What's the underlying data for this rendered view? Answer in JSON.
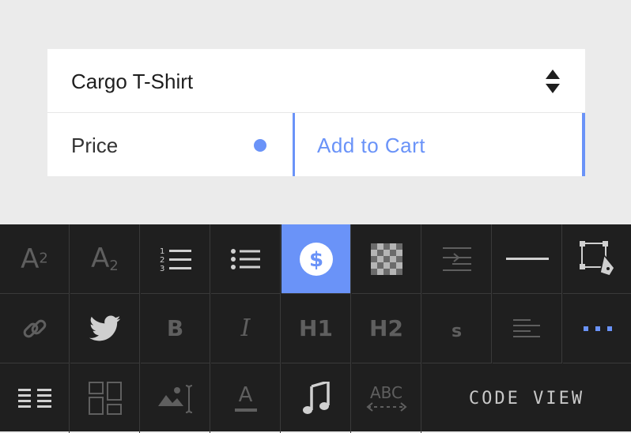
{
  "product": {
    "name": "Cargo T-Shirt"
  },
  "price_row": {
    "label": "Price",
    "cart_label": "Add to Cart"
  },
  "colors": {
    "accent": "#6a93f8",
    "toolbar_bg": "#1f1f1f",
    "icon_gray": "#5f5f5f"
  },
  "toolbar": {
    "row1": [
      {
        "icon": "superscript-icon"
      },
      {
        "icon": "subscript-icon"
      },
      {
        "icon": "ordered-list-icon"
      },
      {
        "icon": "bulleted-list-icon"
      },
      {
        "icon": "dollar-icon",
        "active": true
      },
      {
        "icon": "checkerboard-icon"
      },
      {
        "icon": "indent-icon"
      },
      {
        "icon": "horizontal-rule-icon"
      },
      {
        "icon": "pen-tool-icon"
      }
    ],
    "row2": [
      {
        "icon": "link-icon"
      },
      {
        "icon": "twitter-icon"
      },
      {
        "icon": "bold-icon",
        "label": "B"
      },
      {
        "icon": "italic-icon",
        "label": "I"
      },
      {
        "icon": "heading1-icon",
        "label": "H1"
      },
      {
        "icon": "heading2-icon",
        "label": "H2"
      },
      {
        "icon": "small-text-icon",
        "label": "s"
      },
      {
        "icon": "align-left-icon"
      },
      {
        "icon": "more-icon"
      }
    ],
    "row3": [
      {
        "icon": "list-view-icon"
      },
      {
        "icon": "grid-layout-icon"
      },
      {
        "icon": "image-caption-icon"
      },
      {
        "icon": "text-color-icon",
        "label": "A"
      },
      {
        "icon": "music-note-icon"
      },
      {
        "icon": "spellcheck-icon",
        "label": "ABC"
      }
    ],
    "superscript": {
      "base": "A",
      "exp": "2"
    },
    "subscript": {
      "base": "A",
      "sub": "2"
    },
    "ordered_list_numbers": [
      "1",
      "2",
      "3"
    ],
    "code_view_label": "CODE VIEW"
  }
}
